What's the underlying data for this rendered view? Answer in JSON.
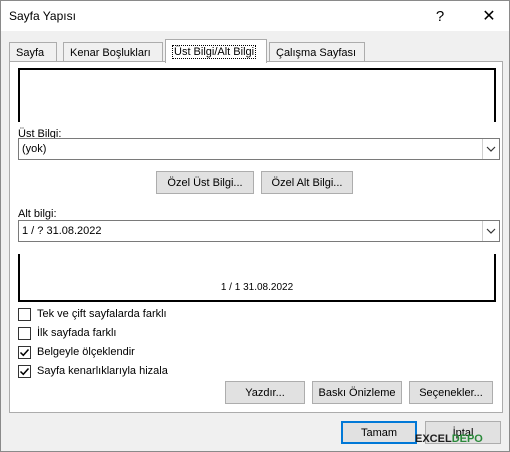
{
  "window": {
    "title": "Sayfa Yapısı",
    "help_label": "?",
    "close_label": "✕"
  },
  "tabs": [
    {
      "label": "Sayfa"
    },
    {
      "label": "Kenar Boşlukları"
    },
    {
      "label": "Üst Bilgi/Alt Bilgi"
    },
    {
      "label": "Çalışma Sayfası"
    }
  ],
  "header": {
    "label": "Üst Bilgi:",
    "value": "(yok)"
  },
  "buttons": {
    "custom_header": "Özel Üst Bilgi...",
    "custom_footer": "Özel Alt Bilgi...",
    "print": "Yazdır...",
    "print_preview": "Baskı Önizleme",
    "options": "Seçenekler...",
    "ok": "Tamam",
    "cancel": "İptal"
  },
  "footer": {
    "label": "Alt bilgi:",
    "value": "1 / ?  31.08.2022",
    "preview_text": "1 / 1 31.08.2022"
  },
  "options": [
    {
      "label": "Tek ve çift sayfalarda farklı",
      "checked": false
    },
    {
      "label": "İlk sayfada farklı",
      "checked": false
    },
    {
      "label": "Belgeyle ölçeklendir",
      "checked": true
    },
    {
      "label": "Sayfa kenarlıklarıyla hizala",
      "checked": true
    }
  ],
  "watermark": {
    "part1": "EXCEL",
    "part2": "DEPO"
  }
}
